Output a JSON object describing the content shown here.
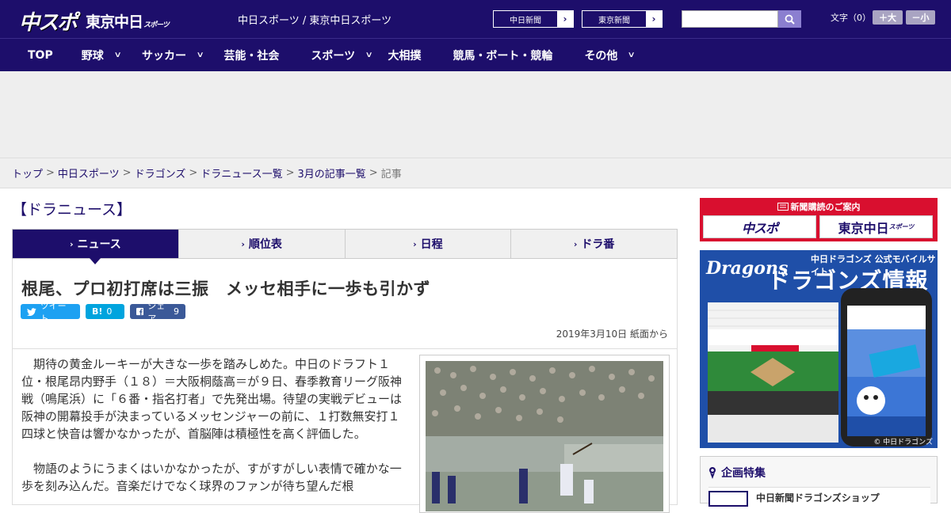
{
  "header": {
    "logo_primary": "中スポ",
    "logo_secondary": "東京中日",
    "logo_secondary_small": "スポーツ",
    "site_name": "中日スポーツ / 東京中日スポーツ",
    "link_chunichi": "中日新聞",
    "link_tokyo": "東京新聞",
    "search_placeholder": "",
    "font_size_label": "文字（0）",
    "font_bigger": "＋大",
    "font_smaller": "－小"
  },
  "nav": {
    "items": [
      {
        "label": "TOP",
        "has_menu": false
      },
      {
        "label": "野球",
        "has_menu": true
      },
      {
        "label": "サッカー",
        "has_menu": true
      },
      {
        "label": "芸能・社会",
        "has_menu": false
      },
      {
        "label": "スポーツ",
        "has_menu": true
      },
      {
        "label": "大相撲",
        "has_menu": false
      },
      {
        "label": "競馬・ボート・競輪",
        "has_menu": false
      },
      {
        "label": "その他",
        "has_menu": true
      }
    ]
  },
  "breadcrumb": {
    "items": [
      "トップ",
      "中日スポーツ",
      "ドラゴンズ",
      "ドラニュース一覧",
      "3月の記事一覧"
    ],
    "current": "記事",
    "separator": ">"
  },
  "section": {
    "title": "【ドラニュース】"
  },
  "tabs": [
    {
      "label": "ニュース",
      "active": true
    },
    {
      "label": "順位表",
      "active": false
    },
    {
      "label": "日程",
      "active": false
    },
    {
      "label": "ドラ番",
      "active": false
    }
  ],
  "article": {
    "headline": "根尾、プロ初打席は三振　メッセ相手に一歩も引かず",
    "share_tweet": "ツイート",
    "share_hatena_label": "B!",
    "share_hatena_count": "0",
    "share_fb_label": "シェア",
    "share_fb_count": "9",
    "date": "2019年3月10日 紙面から",
    "paragraph_1": "期待の黄金ルーキーが大きな一歩を踏みしめた。中日のドラフト１位・根尾昂内野手（１８）＝大阪桐蔭高＝が９日、春季教育リーグ阪神戦（鳴尾浜）に「６番・指名打者」で先発出場。待望の実戦デビューは阪神の開幕投手が決まっているメッセンジャーの前に、１打数無安打１四球と快音は響かなかったが、首脳陣は積極性を高く評価した。",
    "paragraph_2": "物語のようにうまくはいかなかったが、すがすがしい表情で確かな一歩を刻み込んだ。音楽だけでなく球界のファンが待ち望んだ根"
  },
  "sidebar": {
    "subscribe_title": "新聞購読のご案内",
    "subscribe_logo_1": "中スポ",
    "subscribe_logo_2": "東京中日",
    "subscribe_logo_2_small": "スポーツ",
    "dragons_logo": "Dragons",
    "dragons_sub": "中日ドラゴンズ 公式モバイルサイト",
    "dragons_main": "ドラゴンズ情報",
    "dragons_copy": "© 中日ドラゴンズ",
    "kikaku_title": "企画特集",
    "kikaku_item": "中日新聞ドラゴンズショップ"
  },
  "colors": {
    "brand": "#1d0e6b",
    "subscribe_red": "#d90f2f",
    "twitter": "#1da1f2",
    "hatena": "#00a4de",
    "facebook": "#3b5998",
    "dragons_blue": "#1f4fa8"
  }
}
